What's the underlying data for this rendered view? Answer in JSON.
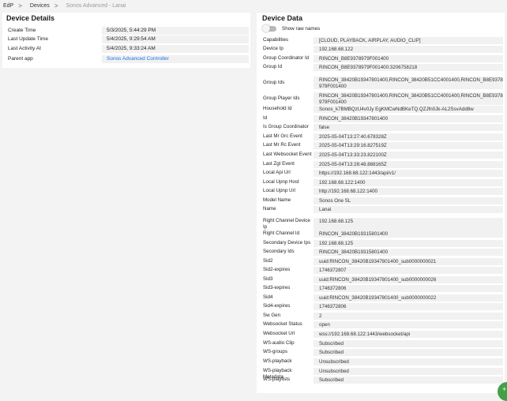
{
  "breadcrumb": {
    "items": [
      "EdP",
      "Devices",
      "Sonos Advanced - Lanai"
    ],
    "separator": ">"
  },
  "device_details": {
    "title": "Device Details",
    "rows": [
      {
        "label": "Create Time",
        "value": "5/3/2025, 5:44:29 PM"
      },
      {
        "label": "Last Update Time",
        "value": "5/4/2025, 9:29:54 AM"
      },
      {
        "label": "Last Activity At",
        "value": "5/4/2025, 9:33:24 AM"
      },
      {
        "label": "Parent app",
        "value": "Sonos Advanced Controller"
      }
    ]
  },
  "device_data": {
    "title": "Device Data",
    "toggle_label": "Show raw names",
    "rows": [
      {
        "label": "Capabilities",
        "value": "[CLOUD, PLAYBACK, AIRPLAY, AUDIO_CLIP]"
      },
      {
        "label": "Device Ip",
        "value": "192.168.68.122"
      },
      {
        "label": "Group Coordinator Id",
        "value": "RINCON_B8E9378979F001400"
      },
      {
        "label": "Group Id",
        "value": "RINCON_B8E9378979F001400:3206758218"
      },
      {
        "label": "Group Ids",
        "value": "RINCON_38420B19347801400,RINCON_38420B51CC4001400,RINCON_B8E9378979F001400"
      },
      {
        "label": "Group Player Ids",
        "value": "RINCON_38420B19347801400,RINCON_38420B51CC4001400,RINCON_B8E9378979F001400"
      },
      {
        "label": "Household Id",
        "value": "Sonos_k7BMBQzU4v0Jy EgKMCwNdBKeTQ.QZJfn0Jk-AL2SsvAdd8w"
      },
      {
        "label": "Id",
        "value": "RINCON_38420B19347801400"
      },
      {
        "label": "Is Group Coordinator",
        "value": "false"
      },
      {
        "label": "Last Mr Grc Event",
        "value": "2025-05-04T13:27:40.678328Z"
      },
      {
        "label": "Last Mr Rc Event",
        "value": "2025-05-04T13:29:16.827519Z"
      },
      {
        "label": "Last Websocket Event",
        "value": "2025-05-04T13:33:23.822100Z"
      },
      {
        "label": "Last Zgt Event",
        "value": "2025-05-04T13:28:48.888165Z"
      },
      {
        "label": "Local Api Url",
        "value": "https://192.168.68.122:1443/api/v1/"
      },
      {
        "label": "Local Upnp Host",
        "value": "192.168.68.122:1400"
      },
      {
        "label": "Local Upnp Url",
        "value": "http://192.168.68.122:1400"
      },
      {
        "label": "Model Name",
        "value": "Sonos One SL"
      },
      {
        "label": "Name",
        "value": "Lanai"
      },
      {
        "label": "Right Channel Device Ip",
        "value": "192.168.68.125"
      },
      {
        "label": "Right Channel Id",
        "value": "RINCON_38420B19315801400"
      },
      {
        "label": "Secondary Device Ips",
        "value": "192.168.68.125"
      },
      {
        "label": "Secondary Ids",
        "value": "RINCON_38420B19315801400"
      },
      {
        "label": "Sid2",
        "value": "uuid:RINCON_38420B19347801400_sub0000000021"
      },
      {
        "label": "Sid2-expires",
        "value": "1746372807"
      },
      {
        "label": "Sid3",
        "value": "uuid:RINCON_38420B19347801400_sub0000000026"
      },
      {
        "label": "Sid3-expires",
        "value": "1746372806"
      },
      {
        "label": "Sid4",
        "value": "uuid:RINCON_38420B19347801400_sub0000000022"
      },
      {
        "label": "Sid4-expires",
        "value": "1746372806"
      },
      {
        "label": "Sw Gen",
        "value": "2"
      },
      {
        "label": "Websocket Status",
        "value": "open"
      },
      {
        "label": "Websocket Url",
        "value": "wss://192.168.68.122:1443/websocket/api"
      },
      {
        "label": "WS-audio Clip",
        "value": "Subscribed"
      },
      {
        "label": "WS-groups",
        "value": "Subscribed"
      },
      {
        "label": "WS-playback",
        "value": "Unsubscribed"
      },
      {
        "label": "WS-playback Metadata",
        "value": "Unsubscribed"
      },
      {
        "label": "WS-playlists",
        "value": "Subscribed"
      }
    ]
  },
  "fab": {
    "icon": "add-icon",
    "color": "#43a047"
  }
}
